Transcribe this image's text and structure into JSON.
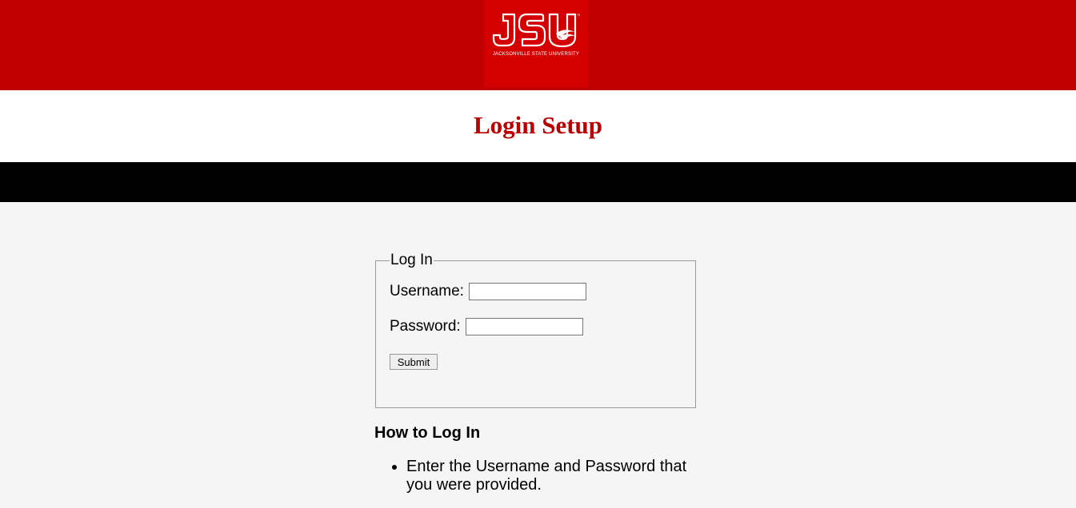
{
  "header": {
    "logo_alt": "JSU",
    "logo_subtitle": "JACKSONVILLE STATE UNIVERSITY"
  },
  "page": {
    "title": "Login Setup"
  },
  "login_form": {
    "legend": "Log In",
    "username_label": "Username:",
    "username_value": "",
    "password_label": "Password:",
    "password_value": "",
    "submit_label": "Submit"
  },
  "help": {
    "heading": "How to Log In",
    "items": [
      "Enter the Username and Password that you were provided."
    ]
  },
  "colors": {
    "banner": "#c00000",
    "logo_box": "#d40000",
    "title": "#b90000",
    "bar": "#000000",
    "background": "#f5f5f5"
  }
}
